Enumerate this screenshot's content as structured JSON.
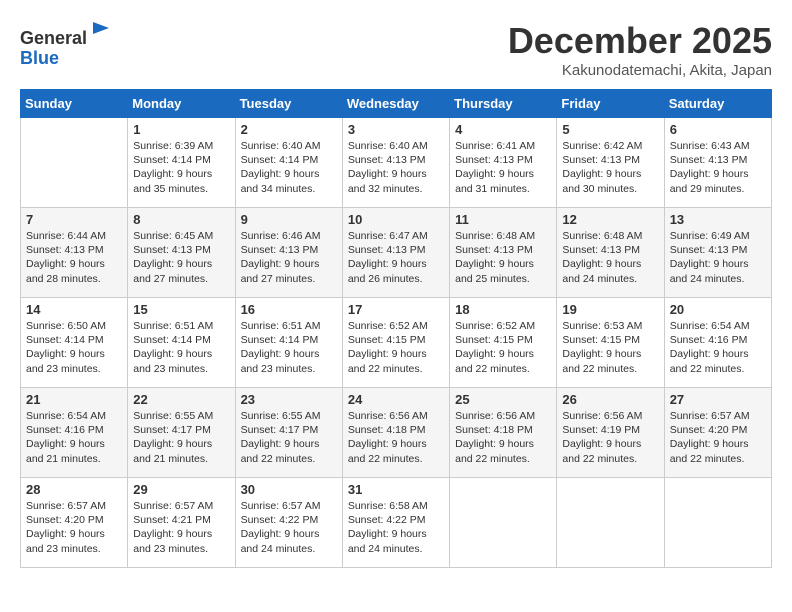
{
  "header": {
    "logo_line1": "General",
    "logo_line2": "Blue",
    "title": "December 2025",
    "subtitle": "Kakunodatemachi, Akita, Japan"
  },
  "weekdays": [
    "Sunday",
    "Monday",
    "Tuesday",
    "Wednesday",
    "Thursday",
    "Friday",
    "Saturday"
  ],
  "weeks": [
    [
      {
        "day": "",
        "sunrise": "",
        "sunset": "",
        "daylight": ""
      },
      {
        "day": "1",
        "sunrise": "Sunrise: 6:39 AM",
        "sunset": "Sunset: 4:14 PM",
        "daylight": "Daylight: 9 hours and 35 minutes."
      },
      {
        "day": "2",
        "sunrise": "Sunrise: 6:40 AM",
        "sunset": "Sunset: 4:14 PM",
        "daylight": "Daylight: 9 hours and 34 minutes."
      },
      {
        "day": "3",
        "sunrise": "Sunrise: 6:40 AM",
        "sunset": "Sunset: 4:13 PM",
        "daylight": "Daylight: 9 hours and 32 minutes."
      },
      {
        "day": "4",
        "sunrise": "Sunrise: 6:41 AM",
        "sunset": "Sunset: 4:13 PM",
        "daylight": "Daylight: 9 hours and 31 minutes."
      },
      {
        "day": "5",
        "sunrise": "Sunrise: 6:42 AM",
        "sunset": "Sunset: 4:13 PM",
        "daylight": "Daylight: 9 hours and 30 minutes."
      },
      {
        "day": "6",
        "sunrise": "Sunrise: 6:43 AM",
        "sunset": "Sunset: 4:13 PM",
        "daylight": "Daylight: 9 hours and 29 minutes."
      }
    ],
    [
      {
        "day": "7",
        "sunrise": "Sunrise: 6:44 AM",
        "sunset": "Sunset: 4:13 PM",
        "daylight": "Daylight: 9 hours and 28 minutes."
      },
      {
        "day": "8",
        "sunrise": "Sunrise: 6:45 AM",
        "sunset": "Sunset: 4:13 PM",
        "daylight": "Daylight: 9 hours and 27 minutes."
      },
      {
        "day": "9",
        "sunrise": "Sunrise: 6:46 AM",
        "sunset": "Sunset: 4:13 PM",
        "daylight": "Daylight: 9 hours and 27 minutes."
      },
      {
        "day": "10",
        "sunrise": "Sunrise: 6:47 AM",
        "sunset": "Sunset: 4:13 PM",
        "daylight": "Daylight: 9 hours and 26 minutes."
      },
      {
        "day": "11",
        "sunrise": "Sunrise: 6:48 AM",
        "sunset": "Sunset: 4:13 PM",
        "daylight": "Daylight: 9 hours and 25 minutes."
      },
      {
        "day": "12",
        "sunrise": "Sunrise: 6:48 AM",
        "sunset": "Sunset: 4:13 PM",
        "daylight": "Daylight: 9 hours and 24 minutes."
      },
      {
        "day": "13",
        "sunrise": "Sunrise: 6:49 AM",
        "sunset": "Sunset: 4:13 PM",
        "daylight": "Daylight: 9 hours and 24 minutes."
      }
    ],
    [
      {
        "day": "14",
        "sunrise": "Sunrise: 6:50 AM",
        "sunset": "Sunset: 4:14 PM",
        "daylight": "Daylight: 9 hours and 23 minutes."
      },
      {
        "day": "15",
        "sunrise": "Sunrise: 6:51 AM",
        "sunset": "Sunset: 4:14 PM",
        "daylight": "Daylight: 9 hours and 23 minutes."
      },
      {
        "day": "16",
        "sunrise": "Sunrise: 6:51 AM",
        "sunset": "Sunset: 4:14 PM",
        "daylight": "Daylight: 9 hours and 23 minutes."
      },
      {
        "day": "17",
        "sunrise": "Sunrise: 6:52 AM",
        "sunset": "Sunset: 4:15 PM",
        "daylight": "Daylight: 9 hours and 22 minutes."
      },
      {
        "day": "18",
        "sunrise": "Sunrise: 6:52 AM",
        "sunset": "Sunset: 4:15 PM",
        "daylight": "Daylight: 9 hours and 22 minutes."
      },
      {
        "day": "19",
        "sunrise": "Sunrise: 6:53 AM",
        "sunset": "Sunset: 4:15 PM",
        "daylight": "Daylight: 9 hours and 22 minutes."
      },
      {
        "day": "20",
        "sunrise": "Sunrise: 6:54 AM",
        "sunset": "Sunset: 4:16 PM",
        "daylight": "Daylight: 9 hours and 22 minutes."
      }
    ],
    [
      {
        "day": "21",
        "sunrise": "Sunrise: 6:54 AM",
        "sunset": "Sunset: 4:16 PM",
        "daylight": "Daylight: 9 hours and 21 minutes."
      },
      {
        "day": "22",
        "sunrise": "Sunrise: 6:55 AM",
        "sunset": "Sunset: 4:17 PM",
        "daylight": "Daylight: 9 hours and 21 minutes."
      },
      {
        "day": "23",
        "sunrise": "Sunrise: 6:55 AM",
        "sunset": "Sunset: 4:17 PM",
        "daylight": "Daylight: 9 hours and 22 minutes."
      },
      {
        "day": "24",
        "sunrise": "Sunrise: 6:56 AM",
        "sunset": "Sunset: 4:18 PM",
        "daylight": "Daylight: 9 hours and 22 minutes."
      },
      {
        "day": "25",
        "sunrise": "Sunrise: 6:56 AM",
        "sunset": "Sunset: 4:18 PM",
        "daylight": "Daylight: 9 hours and 22 minutes."
      },
      {
        "day": "26",
        "sunrise": "Sunrise: 6:56 AM",
        "sunset": "Sunset: 4:19 PM",
        "daylight": "Daylight: 9 hours and 22 minutes."
      },
      {
        "day": "27",
        "sunrise": "Sunrise: 6:57 AM",
        "sunset": "Sunset: 4:20 PM",
        "daylight": "Daylight: 9 hours and 22 minutes."
      }
    ],
    [
      {
        "day": "28",
        "sunrise": "Sunrise: 6:57 AM",
        "sunset": "Sunset: 4:20 PM",
        "daylight": "Daylight: 9 hours and 23 minutes."
      },
      {
        "day": "29",
        "sunrise": "Sunrise: 6:57 AM",
        "sunset": "Sunset: 4:21 PM",
        "daylight": "Daylight: 9 hours and 23 minutes."
      },
      {
        "day": "30",
        "sunrise": "Sunrise: 6:57 AM",
        "sunset": "Sunset: 4:22 PM",
        "daylight": "Daylight: 9 hours and 24 minutes."
      },
      {
        "day": "31",
        "sunrise": "Sunrise: 6:58 AM",
        "sunset": "Sunset: 4:22 PM",
        "daylight": "Daylight: 9 hours and 24 minutes."
      },
      {
        "day": "",
        "sunrise": "",
        "sunset": "",
        "daylight": ""
      },
      {
        "day": "",
        "sunrise": "",
        "sunset": "",
        "daylight": ""
      },
      {
        "day": "",
        "sunrise": "",
        "sunset": "",
        "daylight": ""
      }
    ]
  ]
}
